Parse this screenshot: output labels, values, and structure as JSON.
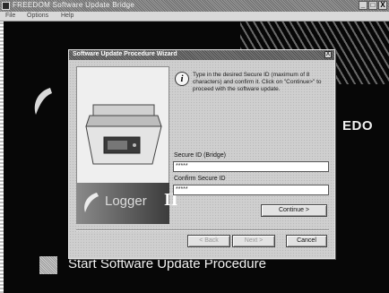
{
  "app": {
    "title": "FREEDOM Software Update Bridge",
    "menu": [
      "File",
      "Options",
      "Help"
    ],
    "controls": [
      "_",
      "□",
      "X"
    ]
  },
  "backdrop": {
    "brand_text": "EDO",
    "start_text": "Start Software Update Procedure"
  },
  "wizard": {
    "title": "Software Update Procedure Wizard",
    "close_label": "X",
    "instruction": "Type in the desired Secure ID (maximum of 8 characters) and confirm it. Click on \"Continue>\" to proceed with the software update.",
    "secure_id_label": "Secure ID (Bridge)",
    "secure_id_value": "*****",
    "confirm_label": "Confirm Secure ID",
    "confirm_value": "*****",
    "continue_label": "Continue >",
    "back_label": "< Back",
    "next_label": "Next >",
    "cancel_label": "Cancel",
    "logo_text": "Logger",
    "logo_version": "II",
    "info_glyph": "i"
  }
}
